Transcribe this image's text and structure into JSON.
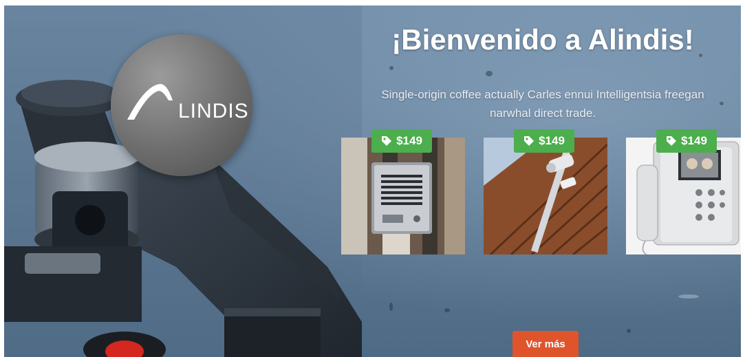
{
  "brand": {
    "logo_text": "LINDIS"
  },
  "hero": {
    "title": "¡Bienvenido a Alindis!",
    "subtitle_line1": "Single-origin coffee actually Carles ennui  Intelligentsia freegan",
    "subtitle_line2": "narwhal direct trade."
  },
  "products": [
    {
      "price": "$149"
    },
    {
      "price": "$149"
    },
    {
      "price": "$149"
    }
  ],
  "cta": {
    "label": "Ver más"
  },
  "colors": {
    "price_badge": "#4cae4c",
    "cta": "#e0542c",
    "background": "#6f8ca7"
  }
}
